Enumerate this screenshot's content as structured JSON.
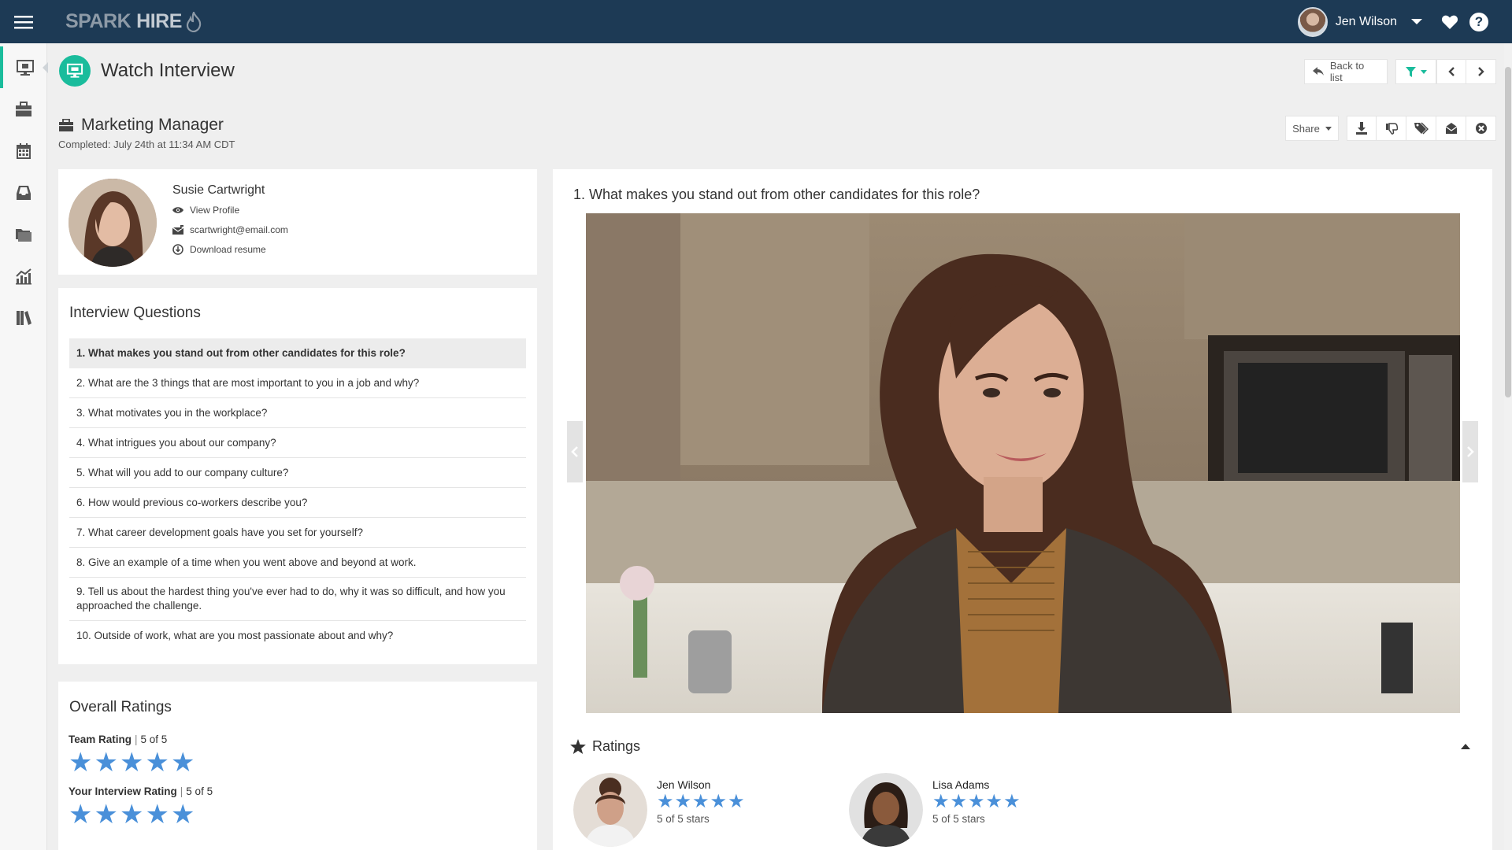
{
  "app": {
    "logo_spark": "SPARK",
    "logo_hire": "HIRE"
  },
  "user": {
    "name": "Jen Wilson"
  },
  "sidebar": {
    "items": [
      {
        "icon": "monitor-icon",
        "active": true
      },
      {
        "icon": "briefcase-icon"
      },
      {
        "icon": "calendar-icon"
      },
      {
        "icon": "inbox-icon"
      },
      {
        "icon": "folders-icon"
      },
      {
        "icon": "chart-icon"
      },
      {
        "icon": "library-icon"
      }
    ]
  },
  "page": {
    "title": "Watch Interview"
  },
  "toolbar": {
    "back_label": "Back to list",
    "share_label": "Share"
  },
  "job": {
    "title": "Marketing Manager",
    "completed": "Completed: July 24th at 11:34 AM CDT"
  },
  "candidate": {
    "name": "Susie Cartwright",
    "view_profile": "View Profile",
    "email": "scartwright@email.com",
    "resume": "Download resume"
  },
  "questions": {
    "title": "Interview Questions",
    "items": [
      "1. What makes you stand out from other candidates for this role?",
      "2. What are the 3 things that are most important to you in a job and why?",
      "3. What motivates you in the workplace?",
      "4. What intrigues you about our company?",
      "5. What will you add to our company culture?",
      "6. How would previous co-workers describe you?",
      "7. What career development goals have you set for yourself?",
      "8. Give an example of a time when you went above and beyond at work.",
      "9. Tell us about the hardest thing you've ever had to do, why it was so difficult, and how you approached the challenge.",
      "10. Outside of work, what are you most passionate about and why?"
    ],
    "active_index": 0
  },
  "overall": {
    "title": "Overall Ratings",
    "team_label": "Team Rating",
    "team_score": "5 of 5",
    "team_stars": 5,
    "yours_label": "Your Interview Rating",
    "yours_score": "5 of 5",
    "yours_stars": 5
  },
  "video": {
    "question": "1. What makes you stand out from other candidates for this role?"
  },
  "ratings": {
    "title": "Ratings",
    "raters": [
      {
        "name": "Jen Wilson",
        "stars": 5,
        "score": "5 of 5 stars"
      },
      {
        "name": "Lisa Adams",
        "stars": 5,
        "score": "5 of 5 stars"
      }
    ]
  },
  "colors": {
    "topbar": "#1d3a55",
    "accent": "#1abc9c",
    "star": "#4a90d9"
  }
}
